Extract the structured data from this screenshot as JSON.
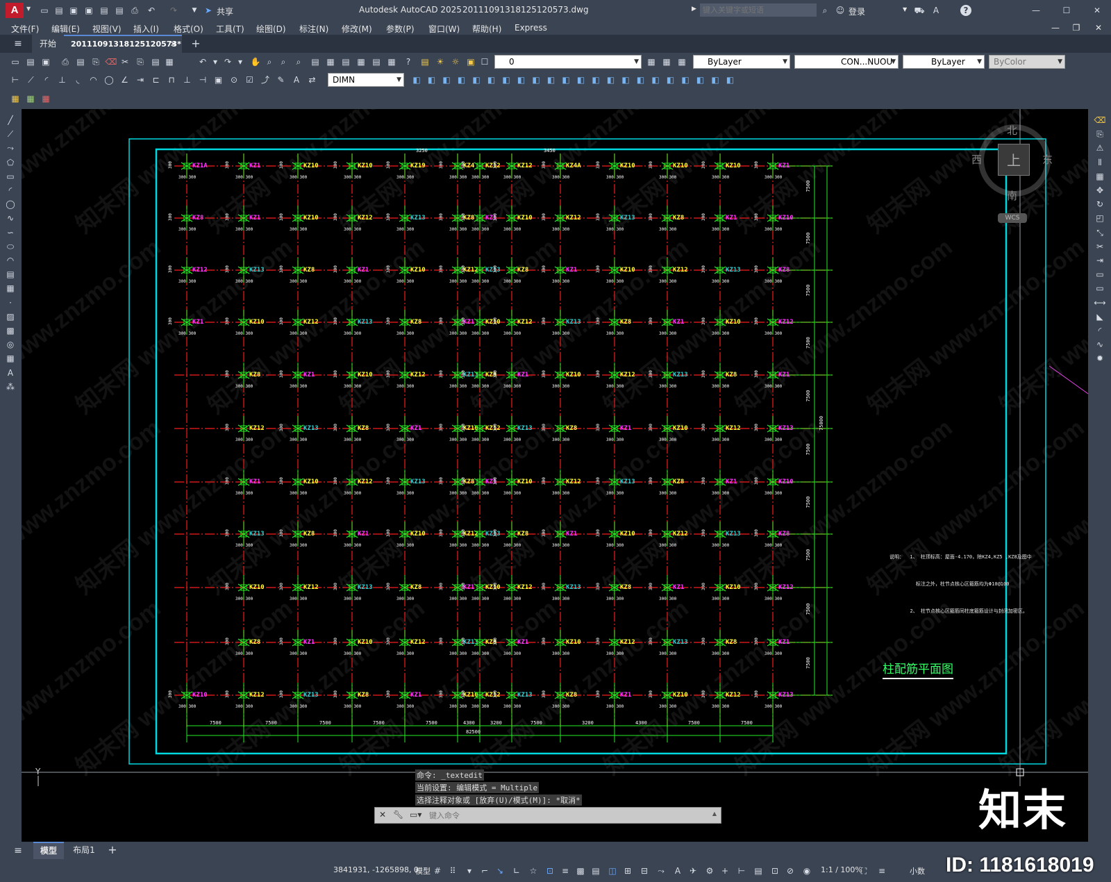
{
  "window": {
    "app_title": "Autodesk AutoCAD 2025",
    "file_name": "20111091318125120573.dwg",
    "search_placeholder": "键入关键字或短语",
    "login": "登录",
    "share": "共享",
    "accent_color": "#c21c2c"
  },
  "menu": {
    "items": [
      "文件(F)",
      "编辑(E)",
      "视图(V)",
      "插入(I)",
      "格式(O)",
      "工具(T)",
      "绘图(D)",
      "标注(N)",
      "修改(M)",
      "参数(P)",
      "窗口(W)",
      "帮助(H)",
      "Express"
    ]
  },
  "tabs": {
    "start": "开始",
    "active": "20111091318125120573*"
  },
  "toolbar": {
    "layer_value": "0",
    "color_value": "ByLayer",
    "linetype_value": "CON...NUOU",
    "lineweight_value": "ByLayer",
    "plotstyle_value": "ByColor",
    "dimstyle_value": "DIMN"
  },
  "viewcube": {
    "north": "北",
    "south": "南",
    "east": "东",
    "west": "西",
    "top": "上",
    "wcs": "WCS"
  },
  "drawing": {
    "title": "柱配筋平面图",
    "note_lines": [
      "说明：  1、 柱顶标高：屋面-4.170，除KZ4,KZ5 ,KZ8及图中",
      "         标注之外，柱节点核心区箍筋均为Φ10@100",
      "       2、 柱节点核心区箍筋同柱底箍筋设计与封闭加密区。"
    ],
    "col_labels": [
      "KZ1A",
      "KZ1",
      "KZ10",
      "KZ10",
      "KZ19",
      "KZ4",
      "KZ12",
      "KZ12",
      "KZ4A",
      "KZ10",
      "KZ10",
      "KZ10",
      "KZ1",
      "KZ1A"
    ],
    "grid_rows": 11,
    "dim_bottom": [
      "7500",
      "7500",
      "7500",
      "7500",
      "7500",
      "4300",
      "3200",
      "7500",
      "3200",
      "4300",
      "7500",
      "7500",
      "7500"
    ],
    "dim_total": "82500",
    "dim_top": [
      "3250",
      "3450"
    ],
    "dim_right": [
      "7500",
      "7500",
      "7500",
      "7500",
      "7500",
      "7500",
      "7500",
      "7500",
      "7500",
      "7500"
    ],
    "dim_right_total": "75000"
  },
  "command": {
    "history": [
      "命令: _textedit",
      "当前设置: 编辑模式 = Multiple",
      "选择注释对象或 [放弃(U)/模式(M)]: *取消*"
    ],
    "input_placeholder": "键入命令"
  },
  "layout_tabs": {
    "model": "模型",
    "layout1": "布局1"
  },
  "status": {
    "coords": "3841931, -1265898, 0",
    "mode": "模型",
    "scale": "1:1 / 100%",
    "units": "小数"
  },
  "watermark": {
    "brand": "知末",
    "id": "ID: 1181618019"
  }
}
